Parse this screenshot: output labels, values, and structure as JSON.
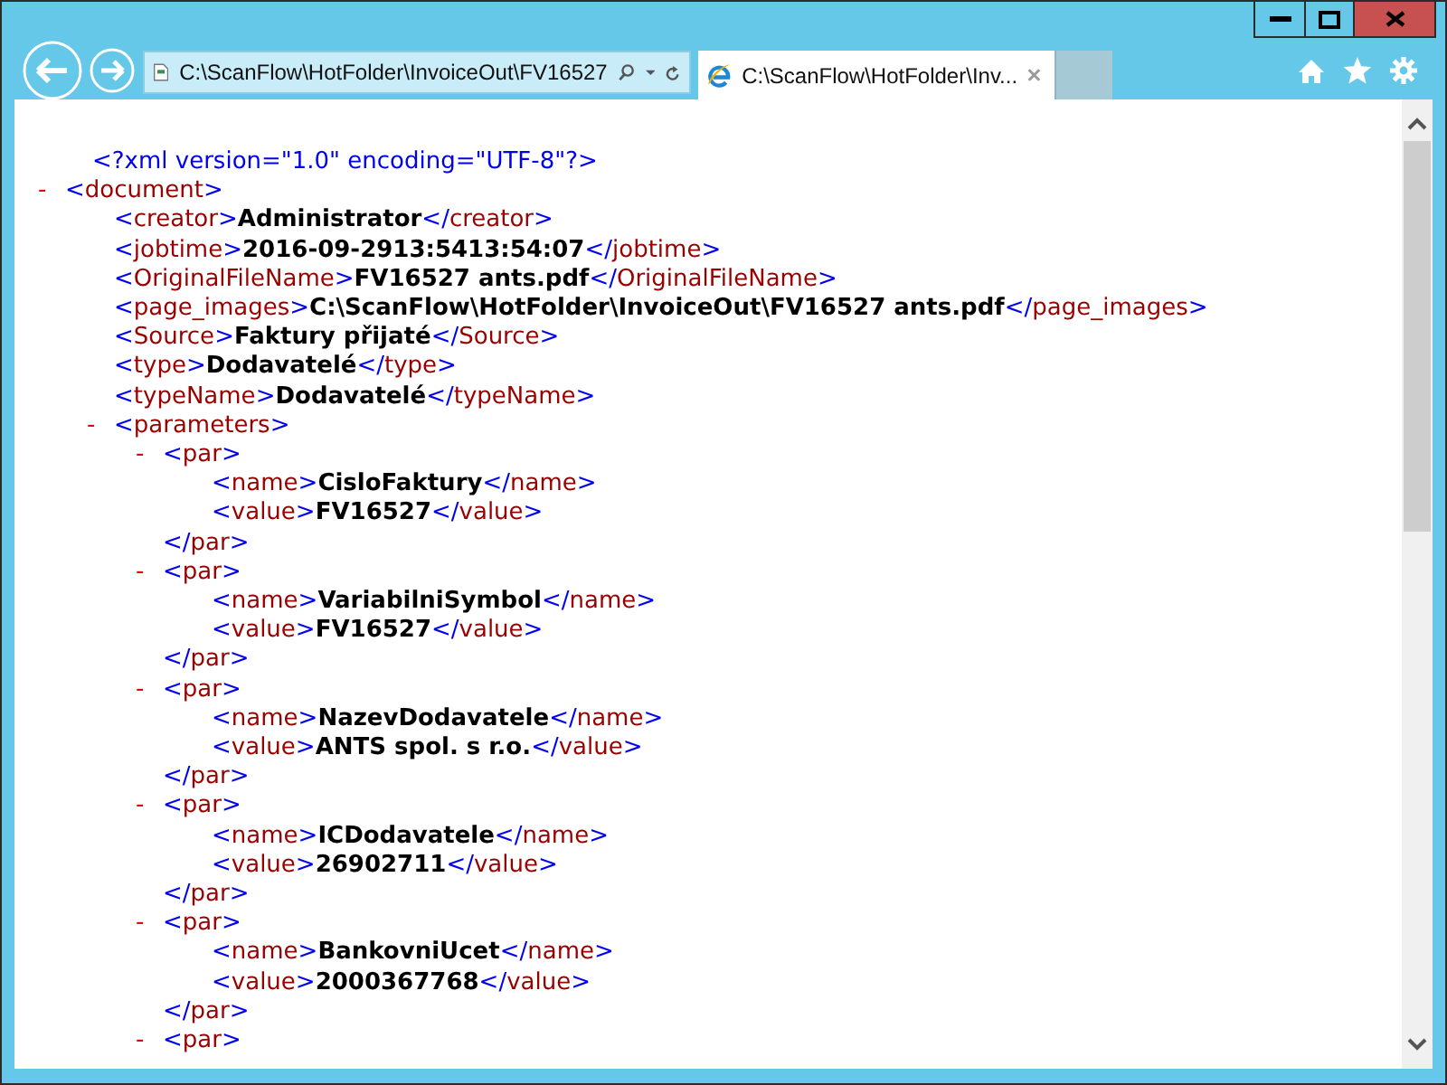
{
  "address_bar": {
    "value": "C:\\ScanFlow\\HotFolder\\InvoiceOut\\FV16527"
  },
  "tabs": [
    {
      "label": "C:\\ScanFlow\\HotFolder\\Inv...",
      "selected": true
    }
  ],
  "xml": {
    "declaration": "<?xml version=\"1.0\" encoding=\"UTF-8\"?>",
    "root": {
      "kind": "container",
      "toggle": "-",
      "open_tag": "<document>",
      "children": [
        {
          "kind": "element",
          "open_tag": "<creator>",
          "value": "Administrator",
          "close_tag": "</creator>"
        },
        {
          "kind": "element",
          "open_tag": "<jobtime>",
          "value": "2016-09-2913:5413:54:07",
          "close_tag": "</jobtime>"
        },
        {
          "kind": "element",
          "open_tag": "<OriginalFileName>",
          "value": "FV16527 ants.pdf",
          "close_tag": "</OriginalFileName>"
        },
        {
          "kind": "element",
          "open_tag": "<page_images>",
          "value": "C:\\ScanFlow\\HotFolder\\InvoiceOut\\FV16527 ants.pdf",
          "close_tag": "</page_images>"
        },
        {
          "kind": "element",
          "open_tag": "<Source>",
          "value": "Faktury přijaté",
          "close_tag": "</Source>"
        },
        {
          "kind": "element",
          "open_tag": "<type>",
          "value": "Dodavatelé",
          "close_tag": "</type>"
        },
        {
          "kind": "element",
          "open_tag": "<typeName>",
          "value": "Dodavatelé",
          "close_tag": "</typeName>"
        },
        {
          "kind": "container",
          "toggle": "-",
          "open_tag": "<parameters>",
          "children": [
            {
              "kind": "container",
              "toggle": "-",
              "open_tag": "<par>",
              "close_tag": "</par>",
              "children": [
                {
                  "kind": "element",
                  "open_tag": "<name>",
                  "value": "CisloFaktury",
                  "close_tag": "</name>"
                },
                {
                  "kind": "element",
                  "open_tag": "<value>",
                  "value": "FV16527",
                  "close_tag": "</value>"
                }
              ]
            },
            {
              "kind": "container",
              "toggle": "-",
              "open_tag": "<par>",
              "close_tag": "</par>",
              "children": [
                {
                  "kind": "element",
                  "open_tag": "<name>",
                  "value": "VariabilniSymbol",
                  "close_tag": "</name>"
                },
                {
                  "kind": "element",
                  "open_tag": "<value>",
                  "value": "FV16527",
                  "close_tag": "</value>"
                }
              ]
            },
            {
              "kind": "container",
              "toggle": "-",
              "open_tag": "<par>",
              "close_tag": "</par>",
              "children": [
                {
                  "kind": "element",
                  "open_tag": "<name>",
                  "value": "NazevDodavatele",
                  "close_tag": "</name>"
                },
                {
                  "kind": "element",
                  "open_tag": "<value>",
                  "value": "ANTS spol. s r.o.",
                  "close_tag": "</value>"
                }
              ]
            },
            {
              "kind": "container",
              "toggle": "-",
              "open_tag": "<par>",
              "close_tag": "</par>",
              "children": [
                {
                  "kind": "element",
                  "open_tag": "<name>",
                  "value": "ICDodavatele",
                  "close_tag": "</name>"
                },
                {
                  "kind": "element",
                  "open_tag": "<value>",
                  "value": "26902711",
                  "close_tag": "</value>"
                }
              ]
            },
            {
              "kind": "container",
              "toggle": "-",
              "open_tag": "<par>",
              "close_tag": "</par>",
              "children": [
                {
                  "kind": "element",
                  "open_tag": "<name>",
                  "value": "BankovniUcet",
                  "close_tag": "</name>"
                },
                {
                  "kind": "element",
                  "open_tag": "<value>",
                  "value": "2000367768",
                  "close_tag": "</value>"
                }
              ]
            },
            {
              "kind": "container",
              "toggle": "-",
              "open_tag": "<par>"
            }
          ]
        }
      ]
    }
  }
}
